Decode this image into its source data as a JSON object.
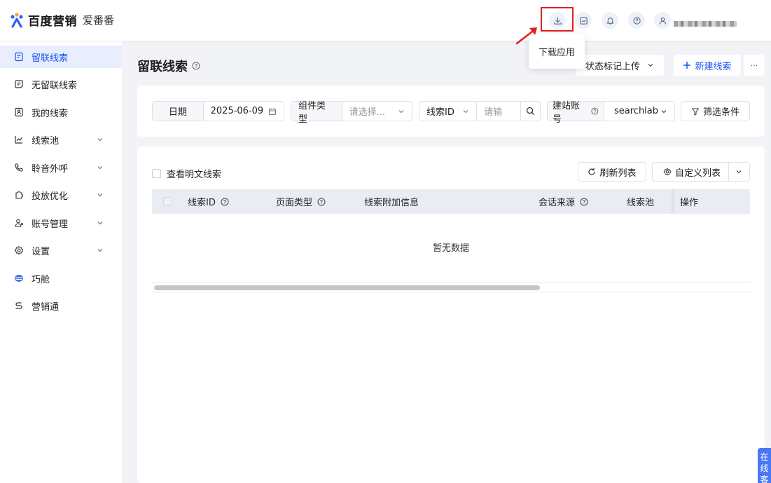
{
  "app": {
    "brand": "百度营销",
    "product": "爱番番",
    "user_name": "■■■■■■"
  },
  "tooltip": {
    "text": "下载应用"
  },
  "sidebar": {
    "items": [
      {
        "label": "留联线索",
        "icon": "lead-doc-icon",
        "active": true,
        "expandable": false
      },
      {
        "label": "无留联线索",
        "icon": "chat-doc-icon",
        "active": false,
        "expandable": false
      },
      {
        "label": "我的线索",
        "icon": "user-doc-icon",
        "active": false,
        "expandable": false
      },
      {
        "label": "线索池",
        "icon": "chart-icon",
        "active": false,
        "expandable": true
      },
      {
        "label": "聆音外呼",
        "icon": "phone-icon",
        "active": false,
        "expandable": true
      },
      {
        "label": "投放优化",
        "icon": "puzzle-icon",
        "active": false,
        "expandable": true
      },
      {
        "label": "账号管理",
        "icon": "account-icon",
        "active": false,
        "expandable": true
      },
      {
        "label": "设置",
        "icon": "gear-icon",
        "active": false,
        "expandable": true
      },
      {
        "label": "巧舱",
        "icon": "qiaocang-icon",
        "active": false,
        "expandable": false
      },
      {
        "label": "营销通",
        "icon": "link-icon",
        "active": false,
        "expandable": false
      }
    ]
  },
  "main": {
    "title": "留联线索",
    "status_upload_label": "状态标记上传",
    "new_lead_label": "新建线索",
    "more_label": "···"
  },
  "filters": {
    "date_label": "日期",
    "date_value": "2025-06-09",
    "component_label": "组件类型",
    "component_placeholder": "请选择...",
    "lead_id_label": "线索ID",
    "lead_id_placeholder": "请输",
    "site_account_label": "建站账号",
    "site_account_value": "searchlab",
    "filter_conditions_label": "筛选条件"
  },
  "table": {
    "show_plain_label": "查看明文线索",
    "refresh_label": "刷新列表",
    "custom_list_label": "自定义列表",
    "columns": [
      "线索ID",
      "页面类型",
      "线索附加信息",
      "会话来源",
      "线索池"
    ],
    "op_column": "操作",
    "empty_text": "暂无数据",
    "scroll_fraction": 0.65
  },
  "float_tab": {
    "label": "在线客"
  },
  "colors": {
    "accent": "#1a54f1",
    "highlight_box": "#e02020"
  }
}
